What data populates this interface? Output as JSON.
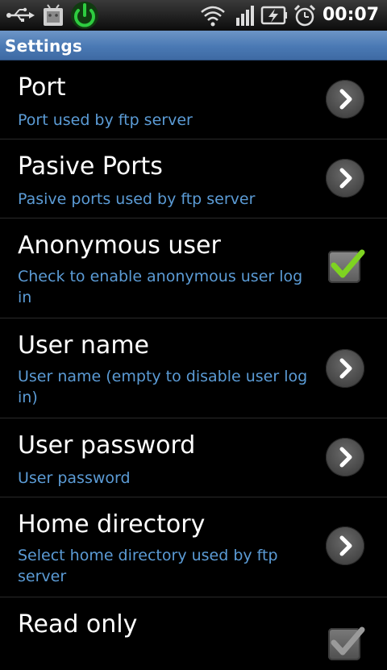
{
  "status_bar": {
    "time": "00:07",
    "icons": [
      "usb-icon",
      "android-debug-icon",
      "power-icon",
      "wifi-icon",
      "signal-icon",
      "battery-charging-icon",
      "alarm-icon"
    ]
  },
  "title": "Settings",
  "items": [
    {
      "title": "Port",
      "summary": "Port used by ftp server",
      "widget": "chevron"
    },
    {
      "title": "Pasive Ports",
      "summary": "Pasive ports used by ftp server",
      "widget": "chevron"
    },
    {
      "title": "Anonymous user",
      "summary": "Check to enable anonymous user log in",
      "widget": "checkbox",
      "checked": true
    },
    {
      "title": "User name",
      "summary": "User name (empty to disable user log in)",
      "widget": "chevron"
    },
    {
      "title": "User password",
      "summary": "User password",
      "widget": "chevron"
    },
    {
      "title": "Home directory",
      "summary": "Select home directory used by ftp server",
      "widget": "chevron"
    },
    {
      "title": "Read only",
      "summary": "",
      "widget": "checkbox",
      "checked": true
    }
  ],
  "colors": {
    "accent": "#5b9bd5",
    "title_bar": "#4a79b4",
    "check_green": "#7ed321"
  }
}
